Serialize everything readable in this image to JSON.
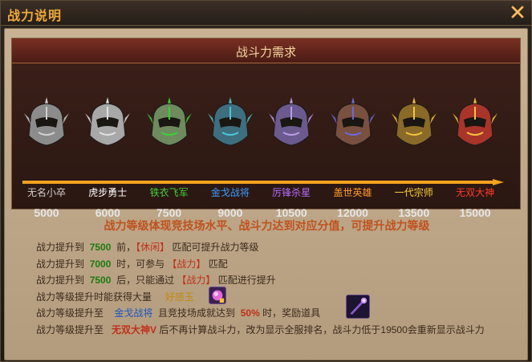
{
  "window": {
    "title": "战力说明"
  },
  "panel": {
    "title": "战斗力需求"
  },
  "ranks": [
    {
      "name": "无名小卒",
      "value": "5000",
      "color": "#cfcfcf",
      "helmet": "#8c8c8c",
      "accent": "#cfcfcf"
    },
    {
      "name": "虎步勇士",
      "value": "6000",
      "color": "#ffffff",
      "helmet": "#a8a8a8",
      "accent": "#e0e0e0"
    },
    {
      "name": "铁衣飞军",
      "value": "7500",
      "color": "#41d23c",
      "helmet": "#6e8a5e",
      "accent": "#3ccf3c"
    },
    {
      "name": "金戈战将",
      "value": "9000",
      "color": "#3c9cff",
      "helmet": "#3f6e7e",
      "accent": "#49c6d6"
    },
    {
      "name": "厉锋杀星",
      "value": "10500",
      "color": "#b66cff",
      "helmet": "#6a5a8e",
      "accent": "#b99be6"
    },
    {
      "name": "盖世英雄",
      "value": "12000",
      "color": "#ff9a2a",
      "helmet": "#7a5040",
      "accent": "#6a6ad8"
    },
    {
      "name": "一代宗师",
      "value": "13500",
      "color": "#ffd035",
      "helmet": "#8a6a28",
      "accent": "#f2c43a"
    },
    {
      "name": "无双大神",
      "value": "15000",
      "color": "#ff3a2a",
      "helmet": "#a8342a",
      "accent": "#f5c040"
    }
  ],
  "description": {
    "headline": "战力等级体现竞技场水平、战斗力达到对应分值，可提升战力等级",
    "lines": [
      {
        "prefix": "战力提升到",
        "value": "7500",
        "mid": "前，",
        "tag": "【休闲】",
        "suffix": "匹配可提升战力等级"
      },
      {
        "prefix": "战力提升到",
        "value": "7000",
        "mid": "时，可参与",
        "tag": "【战力】",
        "suffix": "匹配"
      },
      {
        "prefix": "战力提升到",
        "value": "7500",
        "mid": "后，只能通过",
        "tag": "【战力】",
        "suffix": "匹配进行提升"
      },
      {
        "prefix": "战力等级提升时能获得大量",
        "item": "好感玉"
      },
      {
        "prefix": "战力等级提升至",
        "rank": "金戈战将",
        "mid": "且竞技场成就达到",
        "pct": "50%",
        "suffix": "时，奖励道具"
      },
      {
        "prefix": "战力等级提升至",
        "rank": "无双大神V",
        "suffix": "后不再计算战斗力，改为显示全服排名，战斗力低于19500会重新显示战斗力"
      }
    ]
  }
}
